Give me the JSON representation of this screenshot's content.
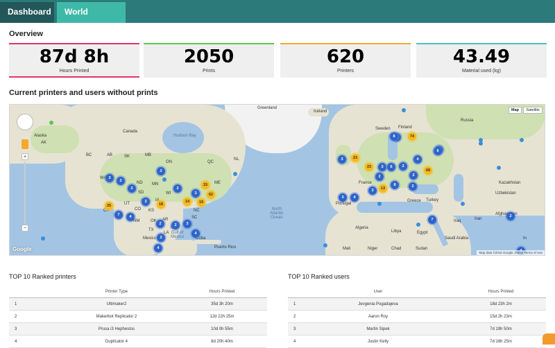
{
  "tabs": [
    {
      "label": "Dashboard"
    },
    {
      "label": "World statistics"
    }
  ],
  "overview": {
    "title": "Overview",
    "cards": [
      {
        "value": "87d 8h",
        "label": "Hours Printed",
        "color": "#e8306a"
      },
      {
        "value": "2050",
        "label": "Prints",
        "color": "#5cc84d"
      },
      {
        "value": "620",
        "label": "Printers",
        "color": "#f4a92d"
      },
      {
        "value": "43.49",
        "label": "Material used (kg)",
        "color": "#48c2c0"
      }
    ]
  },
  "map": {
    "title": "Current printers and users without prints",
    "map_type_buttons": [
      "Map",
      "Satellite"
    ],
    "attribution": "Map data ©2015 Google, INEGI",
    "terms": "Terms of Use",
    "google_logo": "Google",
    "zoom_in": "+",
    "zoom_out": "−",
    "labels": {
      "greenland": "Greenland",
      "iceland": "Iceland",
      "canada": "Canada",
      "hudson_bay": "Hudson Bay",
      "alaska": "Alaska",
      "ak": "AK",
      "bc": "BC",
      "ab": "AB",
      "sk": "SK",
      "mb": "MB",
      "on": "ON",
      "qc": "QC",
      "nl": "NL",
      "wa": "WA",
      "mt": "MT",
      "nd": "ND",
      "mn": "MN",
      "wi": "WI",
      "sd": "SD",
      "ne": "NE",
      "ia": "IA",
      "ut": "UT",
      "co": "CO",
      "ks": "KS",
      "ca": "CA",
      "nm": "NM",
      "ok": "OK",
      "ar": "AR",
      "ms": "MS",
      "la": "LA",
      "tx": "TX",
      "nc": "NC",
      "sc": "SC",
      "me": "ME",
      "mexico": "Mexico",
      "gulf": "Gulf of\nMexico",
      "cuba": "Cuba",
      "puerto_rico": "Puerto Rico",
      "atlantic": "North\nAtlantic\nOcean",
      "portugal": "Portugal",
      "greece": "Greece",
      "turkey": "Turkey",
      "algeria": "Algeria",
      "libya": "Libya",
      "egypt": "Egypt",
      "mali": "Mali",
      "niger": "Niger",
      "chad": "Chad",
      "sudan": "Sudan",
      "saudi": "Saudi Arabia",
      "iraq": "Iraq",
      "iran": "Iran",
      "afghanistan": "Afghanistan",
      "kazakhstan": "Kazakhstan",
      "uzbekistan": "Uzbekistan",
      "france": "France",
      "finland": "Finland",
      "sweden": "Sweden",
      "russia": "Russia",
      "u": "U",
      "in": "In"
    },
    "markers": [
      {
        "n": "3",
        "c": "b"
      },
      {
        "n": "2",
        "c": "b"
      },
      {
        "n": "2",
        "c": "b"
      },
      {
        "n": "2",
        "c": "b"
      },
      {
        "n": "2",
        "c": "b"
      },
      {
        "n": "3",
        "c": "b"
      },
      {
        "n": "3",
        "c": "b"
      },
      {
        "n": "15",
        "c": "y"
      },
      {
        "n": "62",
        "c": "y"
      },
      {
        "n": "25",
        "c": "y"
      },
      {
        "n": "18",
        "c": "y"
      },
      {
        "n": "14",
        "c": "y"
      },
      {
        "n": "19",
        "c": "y"
      },
      {
        "n": "7",
        "c": "b"
      },
      {
        "n": "4",
        "c": "b"
      },
      {
        "n": "2",
        "c": "b"
      },
      {
        "n": "2",
        "c": "b"
      },
      {
        "n": "3",
        "c": "b"
      },
      {
        "n": "4",
        "c": "b"
      },
      {
        "n": "2",
        "c": "b"
      },
      {
        "n": "4",
        "c": "b"
      },
      {
        "n": "74",
        "c": "y"
      },
      {
        "n": "4",
        "c": "b"
      },
      {
        "n": "3",
        "c": "b"
      },
      {
        "n": "4",
        "c": "b"
      },
      {
        "n": "3",
        "c": "b"
      },
      {
        "n": "23",
        "c": "y"
      },
      {
        "n": "23",
        "c": "y"
      },
      {
        "n": "3",
        "c": "b"
      },
      {
        "n": "6",
        "c": "b"
      },
      {
        "n": "2",
        "c": "b"
      },
      {
        "n": "68",
        "c": "y"
      },
      {
        "n": "2",
        "c": "b"
      },
      {
        "n": "2",
        "c": "b"
      },
      {
        "n": "8",
        "c": "b"
      },
      {
        "n": "13",
        "c": "y"
      },
      {
        "n": "3",
        "c": "b"
      },
      {
        "n": "2",
        "c": "b"
      },
      {
        "n": "3",
        "c": "b"
      },
      {
        "n": "4",
        "c": "b"
      },
      {
        "n": "7",
        "c": "b"
      },
      {
        "n": "2",
        "c": "b"
      },
      {
        "n": "8",
        "c": "b"
      },
      {
        "n": "6",
        "c": "b"
      },
      {
        "n": "4",
        "c": "b"
      }
    ]
  },
  "top_printers": {
    "title": "TOP 10 Ranked printers",
    "headers": [
      "",
      "Printer Type",
      "Hours Printed"
    ],
    "rows": [
      [
        "1",
        "Ultimaker2",
        "35d 3h 20m"
      ],
      [
        "2",
        "Makerbot Replicator 2",
        "12d 22h 25m"
      ],
      [
        "3",
        "Prusa i3 Hephestos",
        "10d 0h 55m"
      ],
      [
        "4",
        "Duplicator 4",
        "8d 20h 40m"
      ]
    ]
  },
  "top_users": {
    "title": "TOP 10 Ranked users",
    "headers": [
      "",
      "User",
      "Hours Printed"
    ],
    "rows": [
      [
        "1",
        "Jevgenia Pogadajeva",
        "18d 23h 2m"
      ],
      [
        "2",
        "Aaron Roy",
        "15d 2h 23m"
      ],
      [
        "3",
        "Martin Sipek",
        "7d 19h 50m"
      ],
      [
        "4",
        "Justin Kelly",
        "7d 16h 25m"
      ]
    ]
  }
}
